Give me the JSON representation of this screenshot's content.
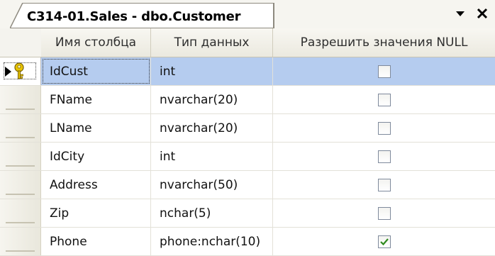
{
  "tab": {
    "title": "C314-01.Sales - dbo.Customer",
    "menu_glyph": "▾",
    "close_glyph": "×"
  },
  "columns": {
    "name": "Имя столбца",
    "type": "Тип данных",
    "allow_null": "Разрешить значения NULL"
  },
  "rows": [
    {
      "name": "IdCust",
      "type": "int",
      "allow_null": false,
      "primary_key": true,
      "selected": true
    },
    {
      "name": "FName",
      "type": "nvarchar(20)",
      "allow_null": false
    },
    {
      "name": "LName",
      "type": "nvarchar(20)",
      "allow_null": false
    },
    {
      "name": "IdCity",
      "type": "int",
      "allow_null": false
    },
    {
      "name": "Address",
      "type": "nvarchar(50)",
      "allow_null": false
    },
    {
      "name": "Zip",
      "type": "nchar(5)",
      "allow_null": false
    },
    {
      "name": "Phone",
      "type": "phone:nchar(10)",
      "allow_null": true
    }
  ],
  "colors": {
    "selected_row": "#b5ccef",
    "check_mark": "#2f8a1e",
    "key_icon": "#e8c400"
  },
  "icons": {
    "row_pointer": "arrow-right-icon",
    "primary_key": "key-icon"
  }
}
